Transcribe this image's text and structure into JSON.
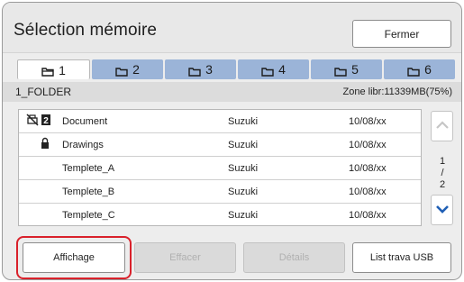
{
  "header": {
    "title": "Sélection mémoire",
    "close_label": "Fermer"
  },
  "tabs": [
    {
      "label": "1",
      "icon": "folder-open-icon",
      "active": true
    },
    {
      "label": "2",
      "icon": "folder-icon",
      "active": false
    },
    {
      "label": "3",
      "icon": "folder-icon",
      "active": false
    },
    {
      "label": "4",
      "icon": "folder-icon",
      "active": false
    },
    {
      "label": "5",
      "icon": "folder-icon",
      "active": false
    },
    {
      "label": "6",
      "icon": "folder-icon",
      "active": false
    }
  ],
  "folder": {
    "name": "1_FOLDER",
    "free_space": "Zone libr:11339MB(75%)"
  },
  "files": [
    {
      "name": "Document",
      "owner": "Suzuki",
      "date": "10/08/xx",
      "icons": [
        "print-disabled-icon",
        "document-mark-icon"
      ]
    },
    {
      "name": "Drawings",
      "owner": "Suzuki",
      "date": "10/08/xx",
      "icons": [
        "lock-icon"
      ]
    },
    {
      "name": "Templete_A",
      "owner": "Suzuki",
      "date": "10/08/xx",
      "icons": []
    },
    {
      "name": "Templete_B",
      "owner": "Suzuki",
      "date": "10/08/xx",
      "icons": []
    },
    {
      "name": "Templete_C",
      "owner": "Suzuki",
      "date": "10/08/xx",
      "icons": []
    }
  ],
  "pager": {
    "current": "1",
    "sep": "/",
    "total": "2"
  },
  "footer": {
    "affichage": "Affichage",
    "effacer": "Effacer",
    "details": "Détails",
    "usb": "List trava USB"
  },
  "colors": {
    "tab_inactive": "#9bb4d8",
    "highlight": "#d9212b",
    "scroll_arrow": "#1f5fb5"
  }
}
